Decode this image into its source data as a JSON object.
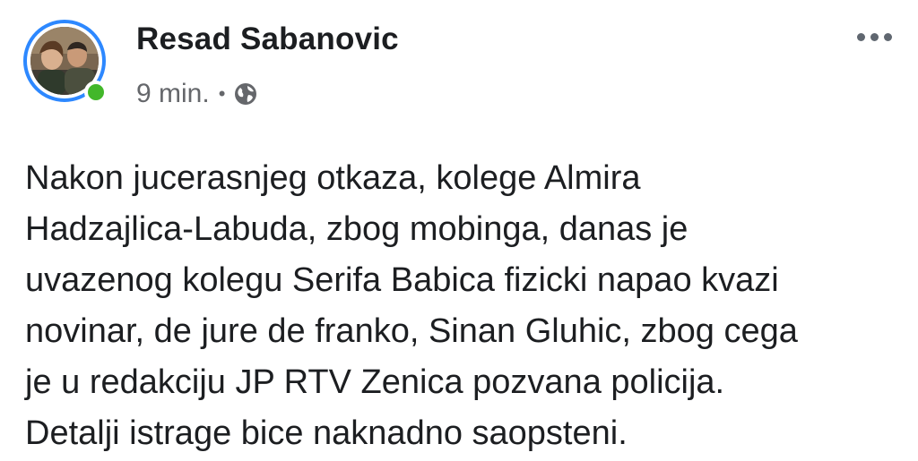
{
  "post": {
    "author": {
      "name": "Resad Sabanovic",
      "online": true
    },
    "meta": {
      "time": "9 min.",
      "separator": "•",
      "privacy_icon": "globe-icon"
    },
    "more_icon": "more-horizontal-icon",
    "text": "Nakon jucerasnjeg otkaza, kolege Almira\nHadzajlica-Labuda, zbog mobinga, danas je\nuvazenog kolegu Serifa Babica fizicki napao kvazi\nnovinar, de jure de franko, Sinan Gluhic, zbog cega\nje u redakciju JP RTV Zenica pozvana policija.\nDetalji istrage bice naknadno saopsteni."
  },
  "colors": {
    "ring": "#2d88ff",
    "online": "#42b72a",
    "meta_text": "#65676b",
    "body_text": "#1c1e21"
  }
}
